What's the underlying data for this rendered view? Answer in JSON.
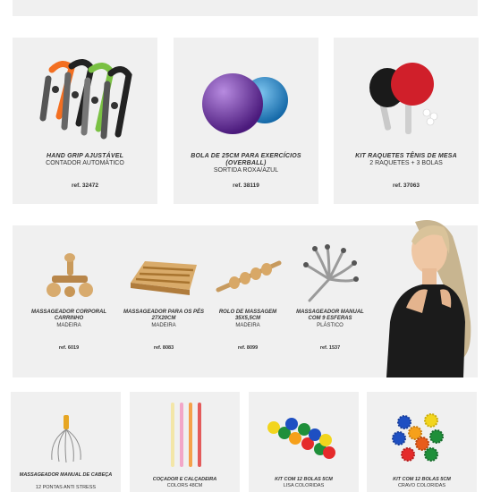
{
  "products_top": [
    {
      "title": "HAND GRIP AJUSTÁVEL",
      "subtitle": "CONTADOR AUTOMÁTICO",
      "ref": "ref. 32472"
    },
    {
      "title": "BOLA DE 25CM PARA EXERCÍCIOS (OVERBALL)",
      "subtitle": "SORTIDA ROXA/AZUL",
      "ref": "ref. 38119"
    },
    {
      "title": "KIT RAQUETES TÊNIS DE MESA",
      "subtitle": "2 RAQUETES + 3 BOLAS",
      "ref": "ref. 37063"
    }
  ],
  "massagers": [
    {
      "title": "MASSAGEADOR CORPORAL CARRINHO",
      "subtitle": "MADEIRA",
      "ref": "ref. 6019"
    },
    {
      "title": "MASSAGEADOR PARA OS PÉS 27X20CM",
      "subtitle": "MADEIRA",
      "ref": "ref. 8083"
    },
    {
      "title": "ROLO DE MASSAGEM 35X5,5CM",
      "subtitle": "MADEIRA",
      "ref": "ref. 8099"
    },
    {
      "title": "MASSAGEADOR MANUAL COM 9 ESFERAS",
      "subtitle": "PLÁSTICO",
      "ref": "ref. 1537"
    }
  ],
  "products_bottom": [
    {
      "title": "MASSAGEADOR MANUAL DE CABEÇA",
      "subtitle": "12 PONTAS ANTI STRESS"
    },
    {
      "title": "COÇADOR E CALÇADEIRA",
      "subtitle": "COLORS 48CM"
    },
    {
      "title": "KIT COM 12 BOLAS 5CM",
      "subtitle": "LISA COLORIDAS"
    },
    {
      "title": "KIT COM 12 BOLAS 5CM",
      "subtitle": "CRAVO COLORIDAS"
    }
  ],
  "colors": {
    "panel": "#f0f0f0",
    "text": "#333333",
    "purple": "#6a2fa0",
    "blue": "#1f82c9",
    "red": "#c8102e"
  },
  "icons": [
    "hand-grip-image",
    "exercise-ball-image",
    "ping-pong-image",
    "massager-car-image",
    "foot-massager-image",
    "massage-roller-image",
    "head-massager-image",
    "model-photo",
    "head-massager-wire-image",
    "back-scratcher-image",
    "smooth-balls-image",
    "spiky-balls-image"
  ]
}
